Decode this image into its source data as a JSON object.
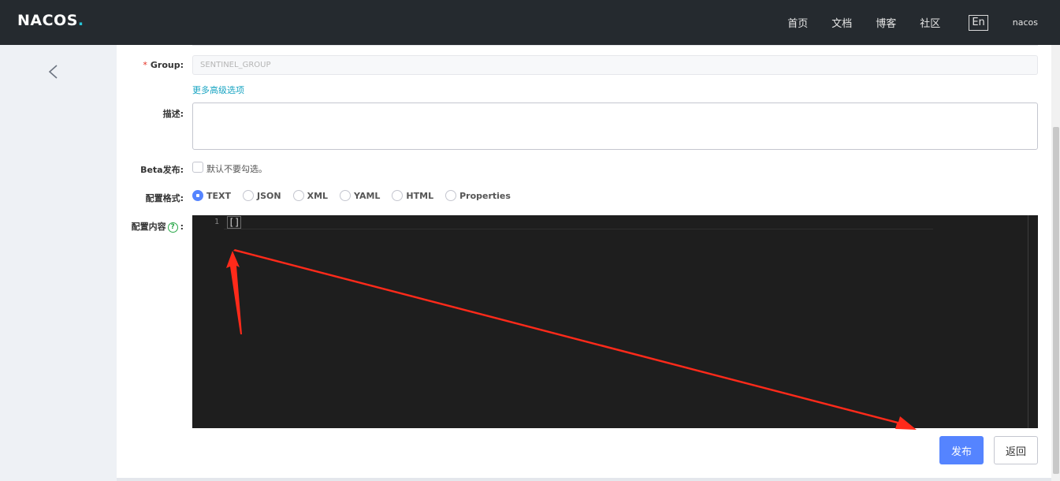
{
  "header": {
    "logo_main": "NACOS",
    "logo_dot": ".",
    "nav": [
      "首页",
      "文档",
      "博客",
      "社区"
    ],
    "lang": "En",
    "user": "nacos"
  },
  "form": {
    "group_label": "Group:",
    "group_required_mark": "*",
    "group_placeholder": "SENTINEL_GROUP",
    "advanced_link": "更多高级选项",
    "desc_label": "描述:",
    "desc_value": "",
    "beta_label": "Beta发布:",
    "beta_hint": "默认不要勾选。",
    "beta_checked": false,
    "format_label": "配置格式:",
    "formats": [
      {
        "label": "TEXT",
        "checked": true
      },
      {
        "label": "JSON",
        "checked": false
      },
      {
        "label": "XML",
        "checked": false
      },
      {
        "label": "YAML",
        "checked": false
      },
      {
        "label": "HTML",
        "checked": false
      },
      {
        "label": "Properties",
        "checked": false
      }
    ],
    "content_label": "配置内容",
    "content_help_glyph": "?",
    "content_colon": ":"
  },
  "editor": {
    "line_numbers": [
      "1"
    ],
    "content": "[]"
  },
  "actions": {
    "publish": "发布",
    "back": "返回"
  },
  "colors": {
    "header_bg": "#252a2f",
    "primary": "#5584ff",
    "link": "#18a4c2",
    "annotation_arrow": "#ff2a1a"
  },
  "icons": {
    "back": "chevron-left-icon",
    "help": "question-circle-icon"
  }
}
